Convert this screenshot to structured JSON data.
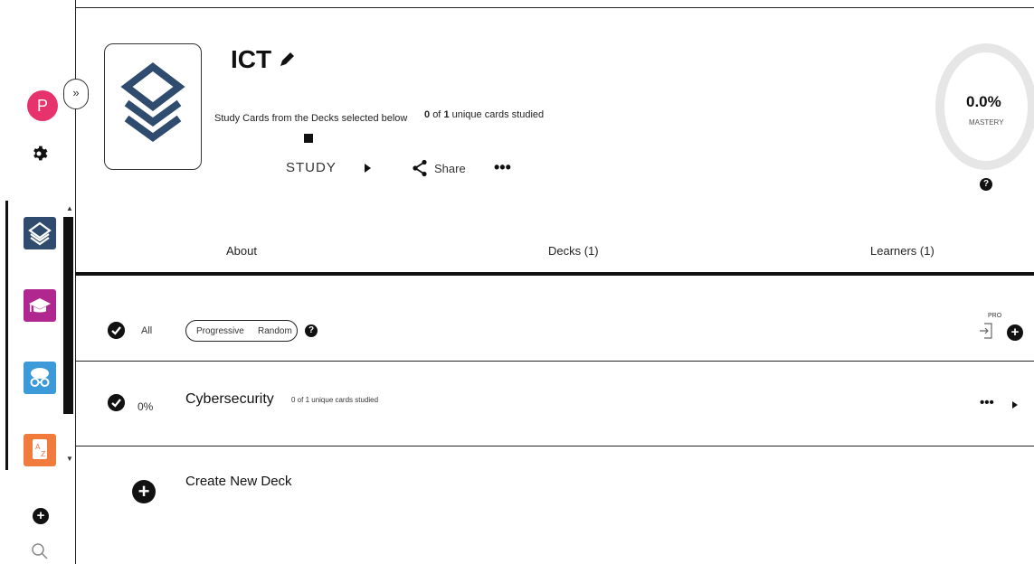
{
  "sidebar": {
    "avatar_letter": "P",
    "expand_label": "»",
    "apps": [
      {
        "name": "decks",
        "color": "#2f4b6e"
      },
      {
        "name": "class",
        "color": "#b0288f"
      },
      {
        "name": "brain",
        "color": "#3d9ad8"
      },
      {
        "name": "flashcards",
        "color": "#f07b3c"
      }
    ]
  },
  "header": {
    "title": "ICT",
    "study_description": "Study Cards from the Decks selected below",
    "progress_count": "0",
    "progress_of": "of",
    "progress_total": "1",
    "progress_suffix": "unique cards studied",
    "study_label": "STUDY",
    "share_label": "Share",
    "more_label": "•••",
    "mastery_value": "0.0%",
    "mastery_label": "MASTERY"
  },
  "tabs": [
    {
      "label": "About"
    },
    {
      "label": "Decks (1)"
    },
    {
      "label": "Learners (1)"
    }
  ],
  "all_row": {
    "label": "All",
    "mode_progressive": "Progressive",
    "mode_random": "Random",
    "pro_label": "PRO"
  },
  "deck_row": {
    "percent": "0%",
    "name": "Cybersecurity",
    "progress": "0 of 1 unique cards studied"
  },
  "create_label": "Create New Deck"
}
